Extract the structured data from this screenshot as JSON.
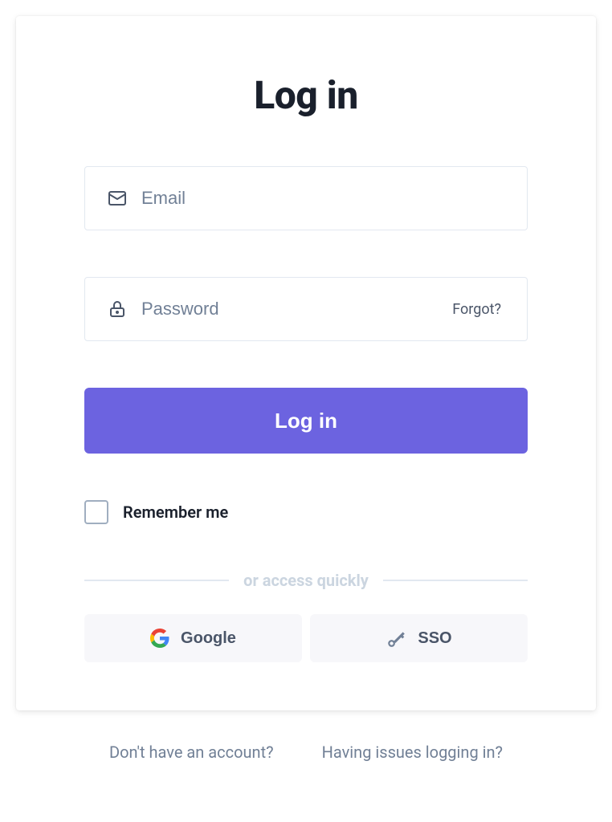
{
  "title": "Log in",
  "email": {
    "placeholder": "Email",
    "value": ""
  },
  "password": {
    "placeholder": "Password",
    "value": "",
    "forgot_label": "Forgot?"
  },
  "login_button_label": "Log in",
  "remember": {
    "label": "Remember me",
    "checked": false
  },
  "divider_text": "or access quickly",
  "oauth": {
    "google_label": "Google",
    "sso_label": "SSO"
  },
  "footer": {
    "signup_prompt": "Don't have an account?",
    "issues_prompt": "Having issues logging in?"
  },
  "colors": {
    "primary": "#6c63e0",
    "text_dark": "#1a202c",
    "text_muted": "#718096"
  }
}
